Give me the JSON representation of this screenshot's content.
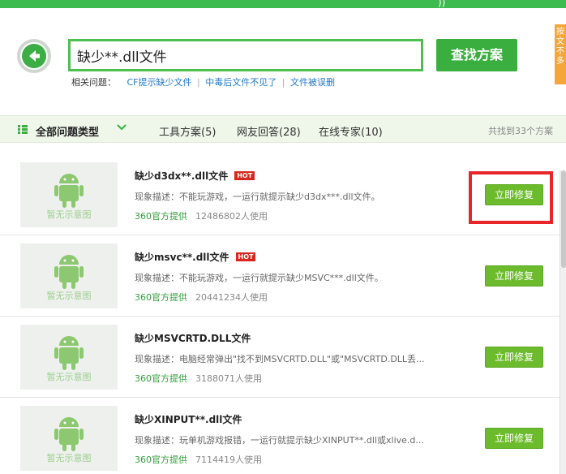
{
  "topbar": {
    "mark": "))"
  },
  "search": {
    "value": "缺少**.dll文件",
    "button_label": "查找方案"
  },
  "side_tab": {
    "text": "按文不多"
  },
  "related": {
    "label": "相关问题：",
    "links": [
      "CF提示缺少文件",
      "中毒后文件不见了",
      "文件被误删"
    ]
  },
  "filter": {
    "all_label": "全部问题类型",
    "tabs": [
      "工具方案(5)",
      "网友回答(28)",
      "在线专家(10)"
    ],
    "count": "共找到33个方案"
  },
  "thumb_label": "暂无示意图",
  "fix_label": "立即修复",
  "hot_label": "HOT",
  "items": [
    {
      "title": "缺少d3dx**.dll文件",
      "hot": true,
      "desc": "现象描述：不能玩游戏，一运行就提示缺少d3dx***.dll文件。",
      "provider": "360官方提供",
      "uses": "12486802人使用"
    },
    {
      "title": "缺少msvc**.dll文件",
      "hot": true,
      "desc": "现象描述：不能玩游戏，一运行就提示缺少MSVC***.dll文件。",
      "provider": "360官方提供",
      "uses": "20441234人使用"
    },
    {
      "title": "缺少MSVCRTD.DLL文件",
      "hot": false,
      "desc": "现象描述：电脑经常弹出\"找不到MSVCRTD.DLL\"或\"MSVCRTD.DLL丢...",
      "provider": "360官方提供",
      "uses": "3188071人使用"
    },
    {
      "title": "缺少XINPUT**.dll文件",
      "hot": false,
      "desc": "现象描述：玩单机游戏报错，一运行就提示缺少XINPUT**.dll或xlive.d...",
      "provider": "360官方提供",
      "uses": "7114419人使用"
    }
  ],
  "colors": {
    "brand_green": "#3aae3f",
    "fix_green": "#6cbb2c",
    "hot_red": "#d9261c",
    "highlight_red": "#e8262a",
    "link_blue": "#2479c6"
  }
}
